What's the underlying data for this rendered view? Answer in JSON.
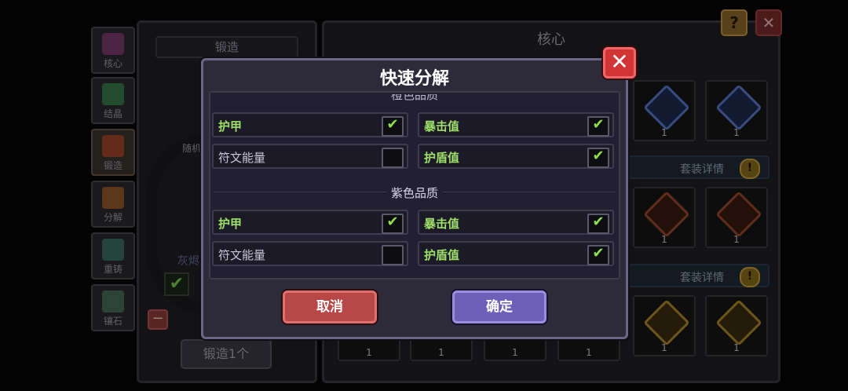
{
  "background": {
    "side_tabs": [
      {
        "label": "核心",
        "color": "#8a3d7a"
      },
      {
        "label": "结晶",
        "color": "#3c8a52"
      },
      {
        "label": "锻造",
        "color": "#b04a2a"
      },
      {
        "label": "分解",
        "color": "#a8622a"
      },
      {
        "label": "重铸",
        "color": "#3d7a6a"
      },
      {
        "label": "镶石",
        "color": "#4a7a62"
      }
    ],
    "forge": {
      "title": "锻造",
      "random_label": "随机",
      "ash_label": "灰烬",
      "check_mark": "✔",
      "minus": "−",
      "forge_button": "锻造1个"
    },
    "core": {
      "title": "核心",
      "set_detail_label": "套装详情",
      "set_detail_icon": "!",
      "gem_count": "1"
    },
    "help_icon": "?",
    "close_icon": "✕"
  },
  "modal": {
    "title": "快速分解",
    "close_icon": "✕",
    "cut_section_title": "橙色品质",
    "sections": [
      {
        "title": "",
        "rows": [
          {
            "left": {
              "label": "护甲",
              "checked": true
            },
            "right": {
              "label": "暴击值",
              "checked": true
            }
          },
          {
            "left": {
              "label": "符文能量",
              "checked": false
            },
            "right": {
              "label": "护盾值",
              "checked": true
            }
          }
        ]
      },
      {
        "title": "紫色品质",
        "rows": [
          {
            "left": {
              "label": "护甲",
              "checked": true
            },
            "right": {
              "label": "暴击值",
              "checked": true
            }
          },
          {
            "left": {
              "label": "符文能量",
              "checked": false
            },
            "right": {
              "label": "护盾值",
              "checked": true
            }
          }
        ]
      }
    ],
    "check_glyph": "✔",
    "cancel_label": "取消",
    "confirm_label": "确定"
  }
}
